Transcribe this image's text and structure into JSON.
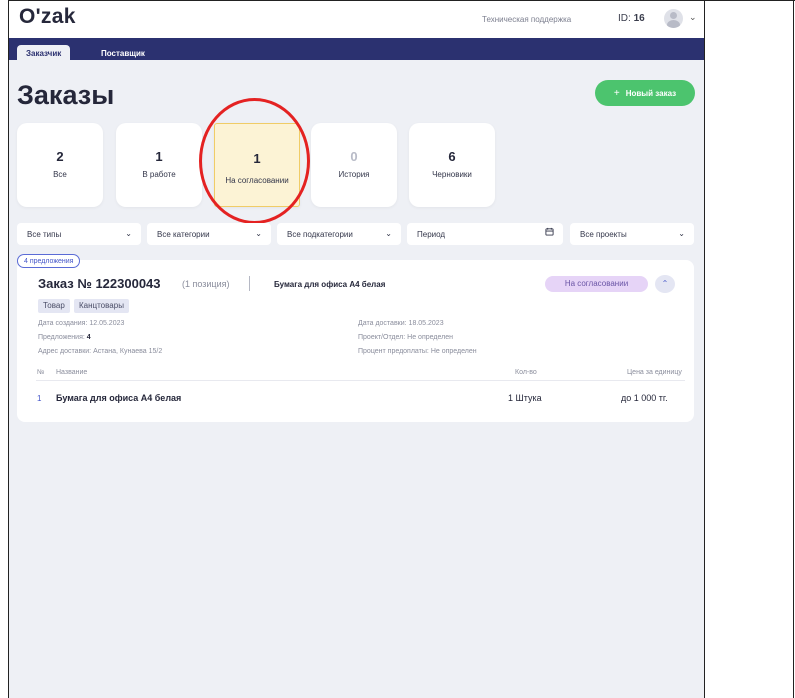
{
  "header": {
    "logo": "O'zak",
    "support": "Техническая поддержка",
    "id_label": "ID:",
    "id_value": "16"
  },
  "nav": {
    "tabs": [
      {
        "label": "Заказчик",
        "active": true
      },
      {
        "label": "Поставщик",
        "active": false
      }
    ]
  },
  "page": {
    "title": "Заказы",
    "new_order_label": "Новый заказ"
  },
  "stats": [
    {
      "value": "2",
      "label": "Все"
    },
    {
      "value": "1",
      "label": "В работе"
    },
    {
      "value": "1",
      "label": "На согласовании",
      "selected": true
    },
    {
      "value": "0",
      "label": "История"
    },
    {
      "value": "6",
      "label": "Черновики"
    }
  ],
  "filters": {
    "types": "Все типы",
    "categories": "Все категории",
    "subcategories": "Все подкатегории",
    "period": "Период",
    "projects": "Все проекты"
  },
  "order": {
    "offers_badge": "4 предложения",
    "title": "Заказ № 122300043",
    "positions": "(1 позиция)",
    "item_name": "Бумага для офиса А4 белая",
    "status": "На согласовании",
    "tags": [
      "Товар",
      "Канцтовары"
    ],
    "created_label": "Дата создания:",
    "created_value": "12.05.2023",
    "offers_label": "Предложения:",
    "offers_value": "4",
    "address_label": "Адрес доставки:",
    "address_value": "Астана, Кунаева 15/2",
    "delivery_label": "Дата доставки:",
    "delivery_value": "18.05.2023",
    "project_label": "Проект/Отдел:",
    "project_value": "Не определен",
    "prepay_label": "Процент предоплаты:",
    "prepay_value": "Не определен",
    "table": {
      "headers": {
        "num": "№",
        "name": "Название",
        "qty": "Кол-во",
        "price": "Цена за единицу"
      },
      "rows": [
        {
          "num": "1",
          "name": "Бумага для офиса А4 белая",
          "qty": "1 Штука",
          "price": "до 1 000 тг."
        }
      ]
    }
  },
  "colors": {
    "navbar": "#2b3170",
    "accent_green": "#4cc46e",
    "selected_card": "#fcf3d5",
    "annotation_red": "#e42222"
  }
}
